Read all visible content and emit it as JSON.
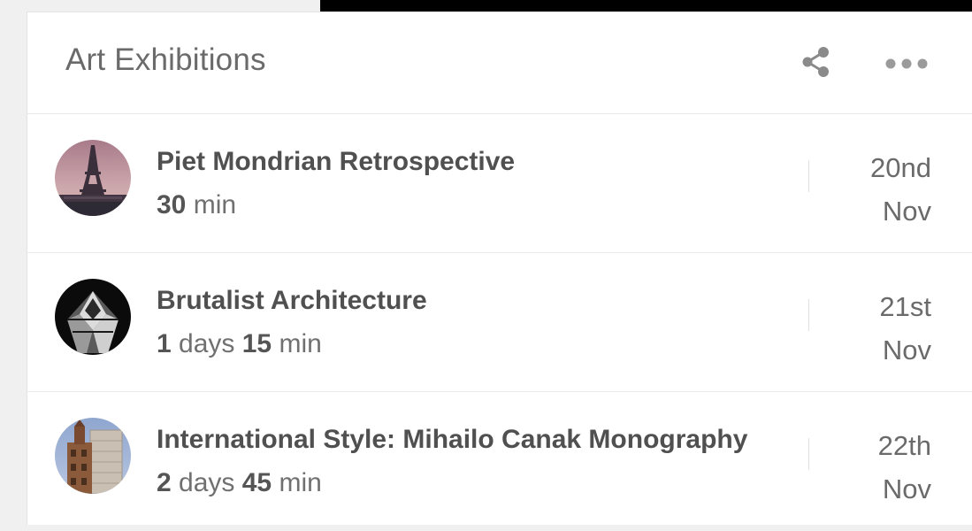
{
  "widget": {
    "title": "Art Exhibitions",
    "share_icon": "share-icon",
    "more_icon": "more-horizontal-icon"
  },
  "exhibitions": [
    {
      "title": "Piet Mondrian Retrospective",
      "days_value": "",
      "days_unit": "",
      "minutes_value": "30",
      "minutes_unit": "min",
      "date_day": "20nd",
      "date_month": "Nov",
      "avatar_icon": "eiffel-tower-photo"
    },
    {
      "title": "Brutalist Architecture",
      "days_value": "1",
      "days_unit": "days",
      "minutes_value": "15",
      "minutes_unit": "min",
      "date_day": "21st",
      "date_month": "Nov",
      "avatar_icon": "brutalist-building-photo"
    },
    {
      "title": "International Style: Mihailo Canak Monography",
      "days_value": "2",
      "days_unit": "days",
      "minutes_value": "45",
      "minutes_unit": "min",
      "date_day": "22th",
      "date_month": "Nov",
      "avatar_icon": "modernist-building-photo"
    }
  ]
}
